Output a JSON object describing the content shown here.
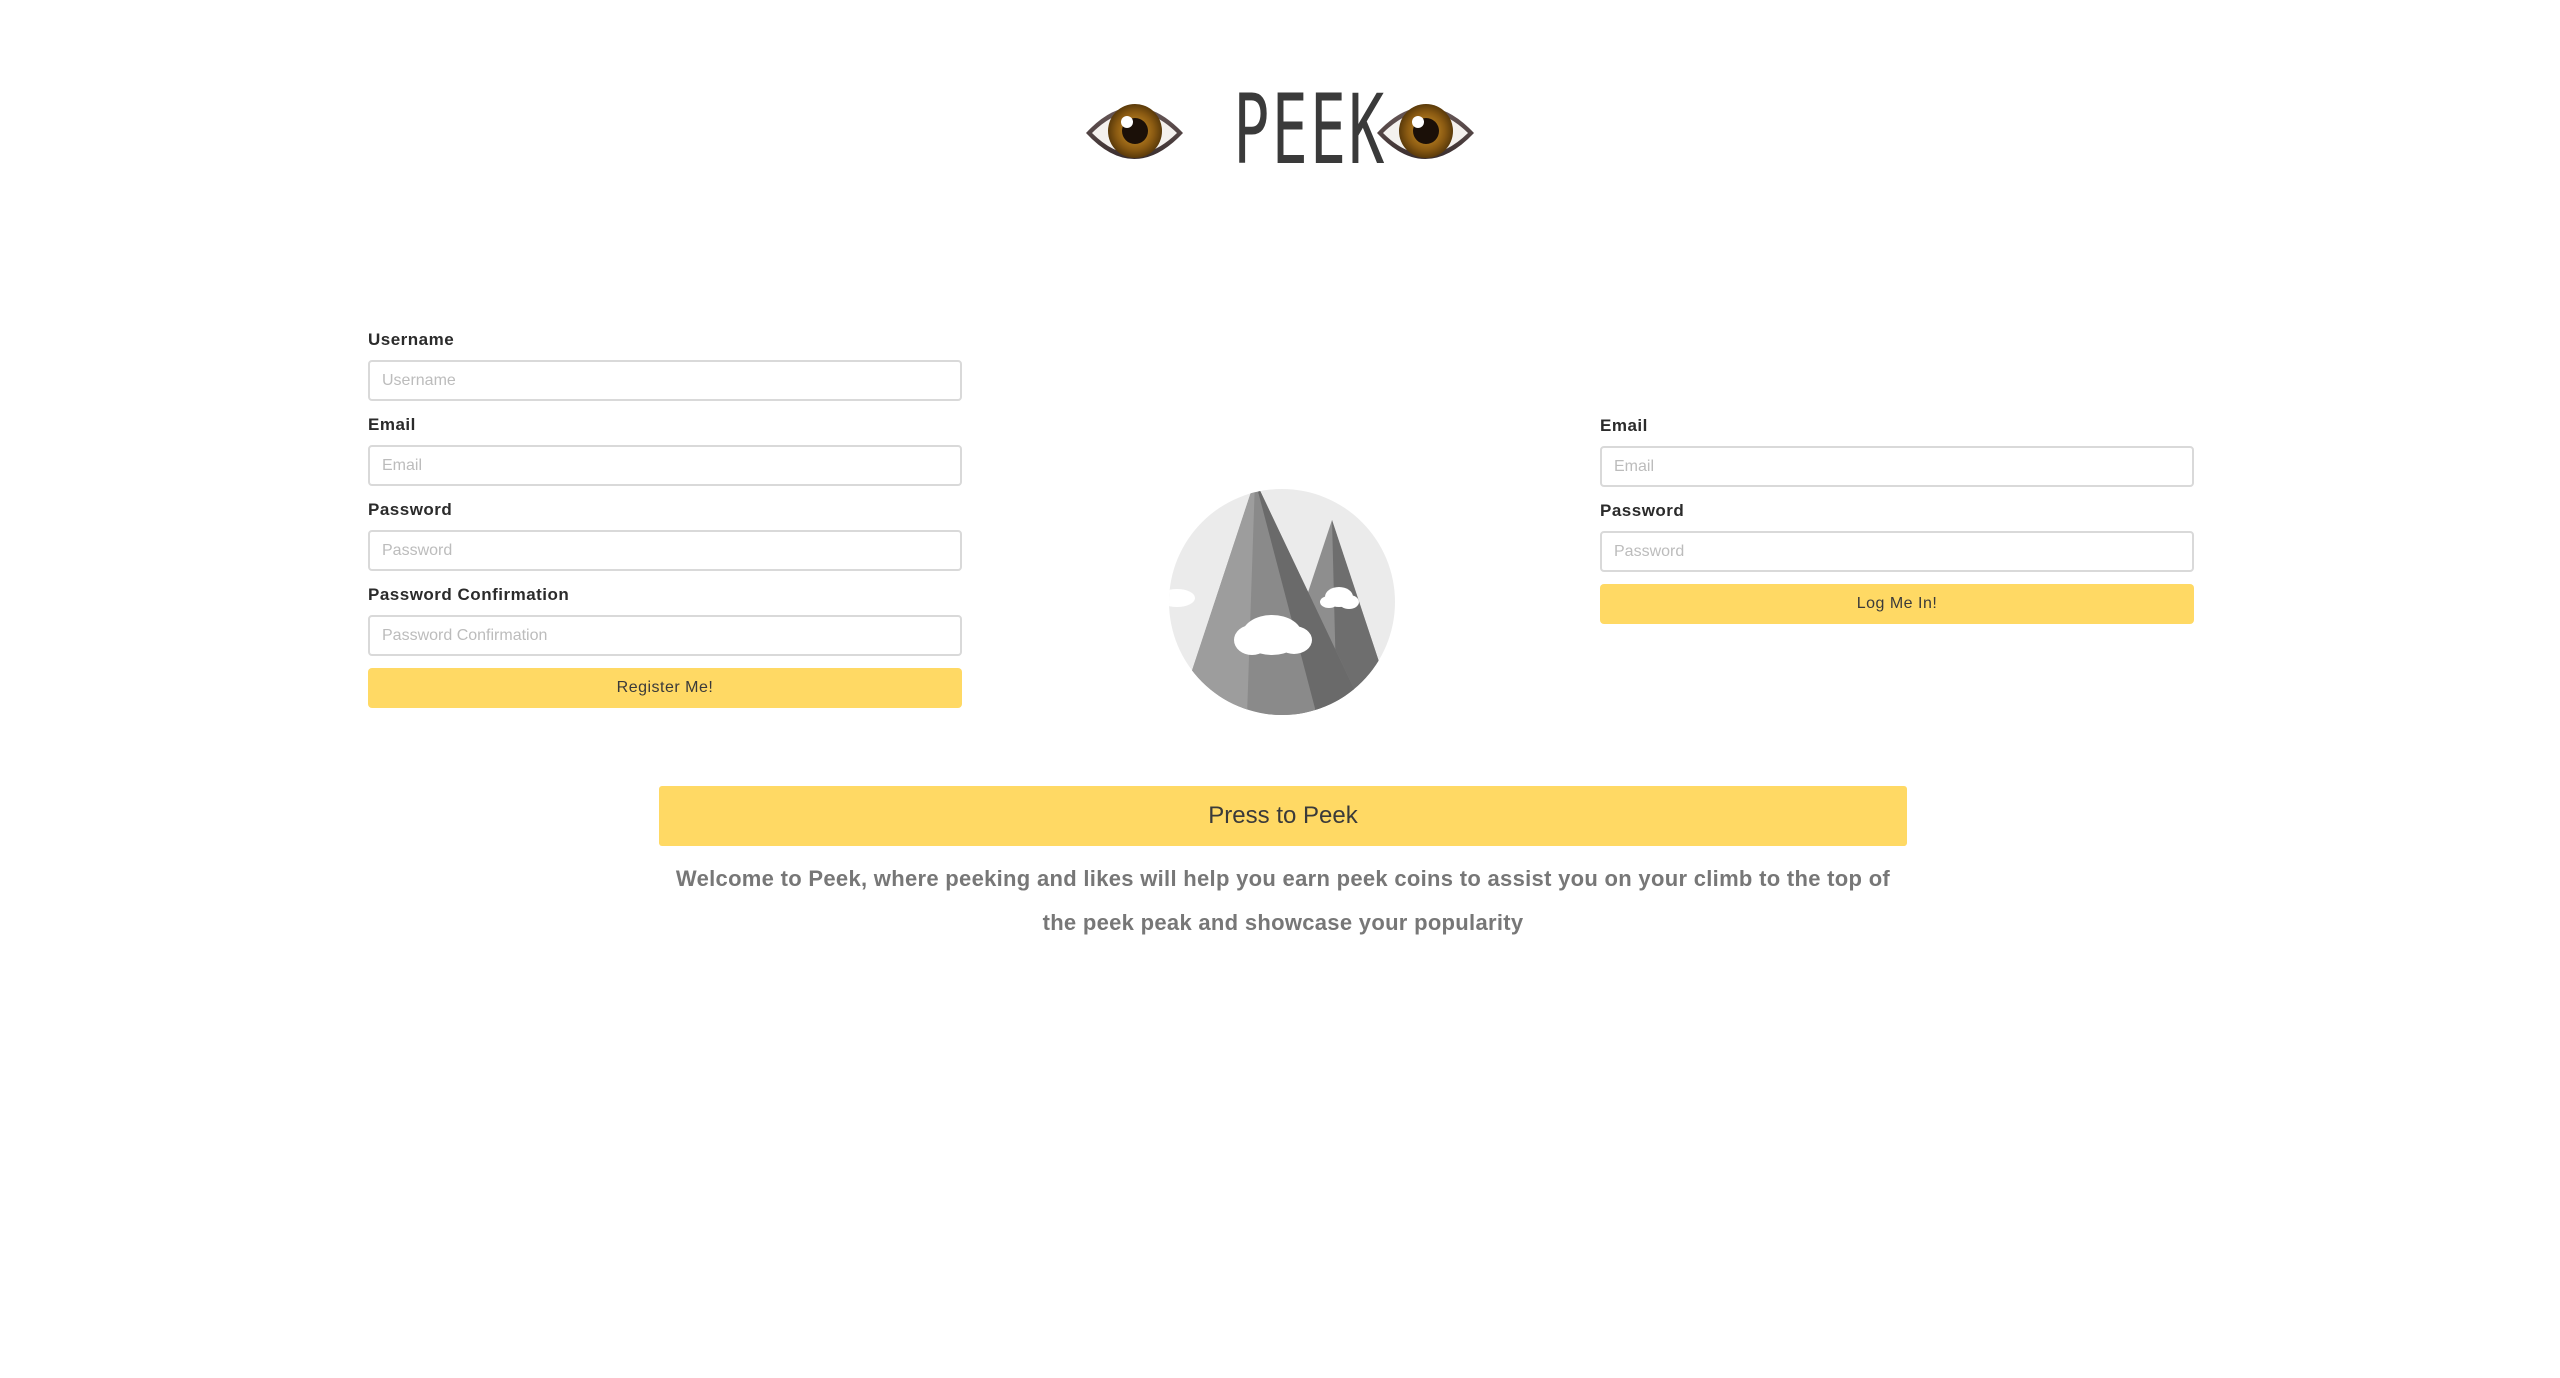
{
  "header": {
    "brand": "PEEK",
    "left_icon": "eye-icon",
    "right_icon": "eye-icon"
  },
  "register": {
    "username_label": "Username",
    "username_placeholder": "Username",
    "email_label": "Email",
    "email_placeholder": "Email",
    "password_label": "Password",
    "password_placeholder": "Password",
    "confirmation_label": "Password Confirmation",
    "confirmation_placeholder": "Password Confirmation",
    "submit_label": "Register Me!"
  },
  "login": {
    "email_label": "Email",
    "email_placeholder": "Email",
    "password_label": "Password",
    "password_placeholder": "Password",
    "submit_label": "Log Me In!"
  },
  "center_image": "mountain-icon",
  "peek_button_label": "Press to Peek",
  "welcome_text": "Welcome to Peek, where peeking and likes will help you earn peek coins to assist you on your climb to the top of the peek peak and showcase your popularity",
  "colors": {
    "accent": "#ffd964",
    "text_muted": "#777777",
    "input_border": "#d9d9d9"
  }
}
